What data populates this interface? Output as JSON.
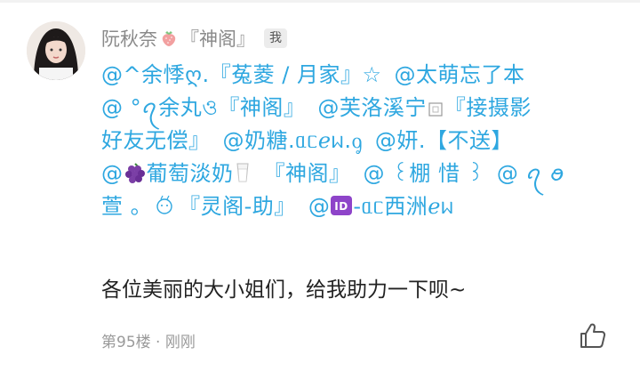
{
  "post": {
    "username": "阮秋奈",
    "group_tag": "『神阁』",
    "me_badge": "我",
    "mentions": {
      "line1": [
        "@^余悸ღ.『菟菱 / 月家』☆",
        "@太萌忘了本"
      ],
      "line2_a": "@ °ꪖ余丸ও『神阁』",
      "line2_b": "@芙洛溪宁",
      "line2_c": "『接摄影",
      "line3_a": "好友无偿』",
      "line3_b": "@奶糖.ᥲᥴℯᥕ.ᧁ",
      "line3_c": "@妍.【不送】",
      "line4_a": "@",
      "line4_b": "葡萄淡奶",
      "line4_c": "『神阁』",
      "line4_d": "@ ꒰棚 惜 ꒱",
      "line4_e": "@ ꪖ ꪮ",
      "line5_a": "萱 。",
      "line5_b": "『灵阁-助』",
      "line5_c": "@",
      "line5_d": "-ᥲᥴ西洲ℯᥕ"
    },
    "comment": "各位美丽的大小姐们，给我助力一下呗~",
    "floor": "第95楼",
    "separator": "·",
    "time": "刚刚"
  }
}
